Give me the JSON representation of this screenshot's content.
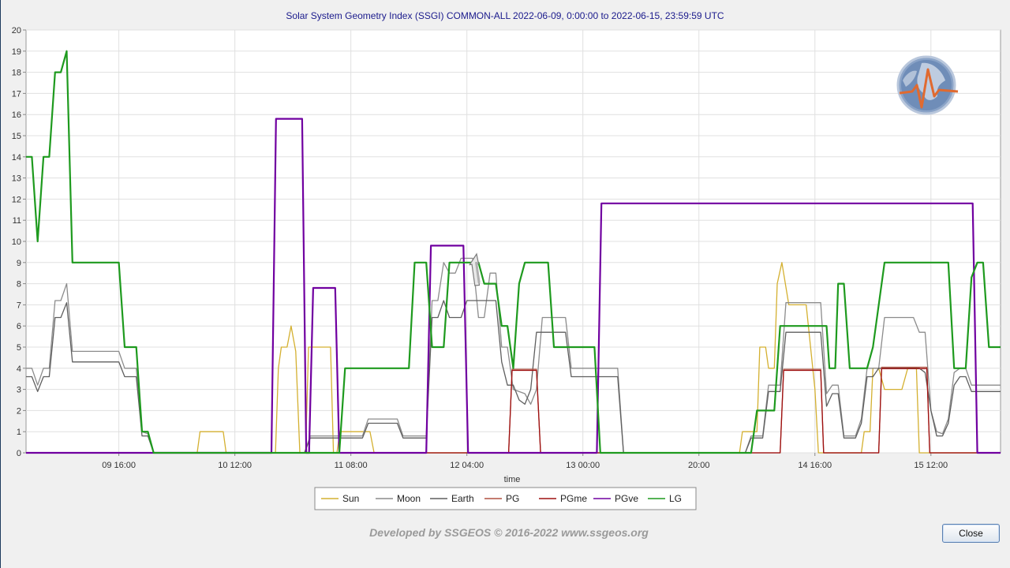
{
  "window": {
    "footer": "Developed by SSGEOS © 2016-2022 www.ssgeos.org",
    "close_label": "Close",
    "logo_icon": "earth-seismograph-logo-icon"
  },
  "chart_data": {
    "type": "line",
    "title": "Solar System Geometry Index (SSGI) COMMON-ALL 2022-06-09,  0:00:00 to 2022-06-15, 23:59:59 UTC",
    "xlabel": "time",
    "ylabel": "",
    "x_unit": "hours from 2022-06-09 00:00 UTC",
    "xlim": [
      0,
      168
    ],
    "ylim": [
      0,
      20
    ],
    "y_ticks": [
      0,
      1,
      2,
      3,
      4,
      5,
      6,
      7,
      8,
      9,
      10,
      11,
      12,
      13,
      14,
      15,
      16,
      17,
      18,
      19,
      20
    ],
    "x_ticks": [
      {
        "x": 16,
        "label": "09 16:00"
      },
      {
        "x": 36,
        "label": "10 12:00"
      },
      {
        "x": 56,
        "label": "11 08:00"
      },
      {
        "x": 76,
        "label": "12 04:00"
      },
      {
        "x": 96,
        "label": "13 00:00"
      },
      {
        "x": 116,
        "label": "20:00"
      },
      {
        "x": 136,
        "label": "14 16:00"
      },
      {
        "x": 156,
        "label": "15 12:00"
      }
    ],
    "grid": true,
    "legend_position": "bottom-center",
    "series": [
      {
        "name": "Sun",
        "color": "#d4b030",
        "points": [
          [
            0,
            0
          ],
          [
            29.5,
            0
          ],
          [
            30,
            1
          ],
          [
            34,
            1
          ],
          [
            34.5,
            0
          ],
          [
            43,
            0
          ],
          [
            43.5,
            4
          ],
          [
            44,
            5
          ],
          [
            45,
            5
          ],
          [
            45.7,
            6
          ],
          [
            46.5,
            4.8
          ],
          [
            47.2,
            0
          ],
          [
            48.2,
            0
          ],
          [
            48.7,
            5
          ],
          [
            52.5,
            5
          ],
          [
            53,
            0
          ],
          [
            53.6,
            0
          ],
          [
            54.1,
            1
          ],
          [
            59.3,
            1
          ],
          [
            60,
            0
          ],
          [
            123,
            0
          ],
          [
            123.5,
            1
          ],
          [
            126,
            1
          ],
          [
            126.5,
            5
          ],
          [
            127.5,
            5
          ],
          [
            128,
            4
          ],
          [
            129,
            4
          ],
          [
            129.5,
            8
          ],
          [
            130.3,
            9
          ],
          [
            131.5,
            7
          ],
          [
            134.5,
            7
          ],
          [
            136,
            3
          ],
          [
            136.6,
            0
          ],
          [
            144,
            0
          ],
          [
            144.5,
            1
          ],
          [
            145.5,
            1
          ],
          [
            146,
            4
          ],
          [
            147,
            4
          ],
          [
            148,
            3
          ],
          [
            151,
            3
          ],
          [
            152,
            4
          ],
          [
            153.5,
            4
          ],
          [
            154,
            0
          ],
          [
            168,
            0
          ]
        ]
      },
      {
        "name": "Moon",
        "color": "#8c8c8c",
        "points": [
          [
            0,
            4
          ],
          [
            1,
            4
          ],
          [
            2,
            3.2
          ],
          [
            3,
            4
          ],
          [
            4,
            4
          ],
          [
            5,
            7.2
          ],
          [
            6,
            7.2
          ],
          [
            7,
            8
          ],
          [
            8,
            4.8
          ],
          [
            16,
            4.8
          ],
          [
            17,
            4
          ],
          [
            19,
            4
          ],
          [
            20,
            1
          ],
          [
            21,
            0.9
          ],
          [
            22,
            0
          ],
          [
            48,
            0
          ],
          [
            49,
            0.8
          ],
          [
            58,
            0.8
          ],
          [
            59,
            1.6
          ],
          [
            64,
            1.6
          ],
          [
            65,
            0.8
          ],
          [
            69,
            0.8
          ],
          [
            70,
            7.2
          ],
          [
            71,
            7.2
          ],
          [
            72,
            9
          ],
          [
            73,
            8.5
          ],
          [
            74,
            8.5
          ],
          [
            75,
            9.2
          ],
          [
            77,
            9.2
          ],
          [
            78,
            6.4
          ],
          [
            79,
            6.4
          ],
          [
            80,
            8.5
          ],
          [
            81,
            8.5
          ],
          [
            82,
            5
          ],
          [
            83,
            5
          ],
          [
            84,
            3
          ],
          [
            86,
            2.8
          ],
          [
            87,
            2.3
          ],
          [
            88,
            3
          ],
          [
            89,
            6.4
          ],
          [
            93,
            6.4
          ],
          [
            94,
            4
          ],
          [
            102,
            4
          ],
          [
            103,
            0
          ],
          [
            124,
            0
          ],
          [
            125,
            0.8
          ],
          [
            127,
            0.8
          ],
          [
            128,
            3.2
          ],
          [
            130,
            3.2
          ],
          [
            131,
            7.1
          ],
          [
            137,
            7.1
          ],
          [
            138,
            2.8
          ],
          [
            139,
            3.2
          ],
          [
            140,
            3.2
          ],
          [
            141,
            0.8
          ],
          [
            143,
            0.8
          ],
          [
            144,
            1.6
          ],
          [
            145,
            4
          ],
          [
            147,
            4
          ],
          [
            148,
            6.4
          ],
          [
            153,
            6.4
          ],
          [
            154,
            5.7
          ],
          [
            155,
            5.7
          ],
          [
            156,
            2
          ],
          [
            157,
            1
          ],
          [
            158,
            0.9
          ],
          [
            159,
            1.6
          ],
          [
            160,
            3.8
          ],
          [
            161,
            4
          ],
          [
            162,
            4
          ],
          [
            163,
            3.2
          ],
          [
            168,
            3.2
          ]
        ]
      },
      {
        "name": "Earth",
        "color": "#5f5f5f",
        "points": [
          [
            0,
            3.6
          ],
          [
            1,
            3.6
          ],
          [
            2,
            2.9
          ],
          [
            3,
            3.6
          ],
          [
            4,
            3.6
          ],
          [
            5,
            6.4
          ],
          [
            6,
            6.4
          ],
          [
            7,
            7.1
          ],
          [
            8,
            4.3
          ],
          [
            16,
            4.3
          ],
          [
            17,
            3.6
          ],
          [
            19,
            3.6
          ],
          [
            20,
            0.8
          ],
          [
            21,
            0.8
          ],
          [
            22,
            0
          ],
          [
            48,
            0
          ],
          [
            49,
            0.7
          ],
          [
            58,
            0.7
          ],
          [
            59,
            1.4
          ],
          [
            64,
            1.4
          ],
          [
            65,
            0.7
          ],
          [
            69,
            0.7
          ],
          [
            70,
            6.4
          ],
          [
            71,
            6.4
          ],
          [
            72,
            7.2
          ],
          [
            73,
            6.4
          ],
          [
            75,
            6.4
          ],
          [
            76,
            7.2
          ],
          [
            81,
            7.2
          ],
          [
            82,
            4.3
          ],
          [
            83,
            3.2
          ],
          [
            84,
            3.2
          ],
          [
            85,
            2.5
          ],
          [
            86,
            2.3
          ],
          [
            87,
            3
          ],
          [
            88,
            5.7
          ],
          [
            93,
            5.7
          ],
          [
            94,
            3.6
          ],
          [
            102,
            3.6
          ],
          [
            103,
            0
          ],
          [
            124,
            0
          ],
          [
            125,
            0.7
          ],
          [
            127,
            0.7
          ],
          [
            128,
            2.9
          ],
          [
            130,
            2.9
          ],
          [
            131,
            5.7
          ],
          [
            137,
            5.7
          ],
          [
            138,
            2.2
          ],
          [
            139,
            2.8
          ],
          [
            140,
            2.8
          ],
          [
            141,
            0.7
          ],
          [
            143,
            0.7
          ],
          [
            144,
            1.4
          ],
          [
            145,
            3.6
          ],
          [
            146,
            3.6
          ],
          [
            147,
            4
          ],
          [
            154,
            4
          ],
          [
            155,
            3.8
          ],
          [
            156,
            2
          ],
          [
            157,
            0.8
          ],
          [
            158,
            0.8
          ],
          [
            159,
            1.4
          ],
          [
            160,
            3.2
          ],
          [
            161,
            3.6
          ],
          [
            162,
            3.6
          ],
          [
            163,
            2.9
          ],
          [
            168,
            2.9
          ]
        ]
      },
      {
        "name": "PG",
        "color": "#b05040",
        "points": [
          [
            0,
            0
          ],
          [
            83.2,
            0
          ],
          [
            83.8,
            3.95
          ],
          [
            88,
            3.95
          ],
          [
            88.7,
            0
          ],
          [
            130,
            0
          ],
          [
            130.6,
            3.95
          ],
          [
            137,
            3.95
          ],
          [
            137.5,
            0
          ],
          [
            147,
            0
          ],
          [
            147.5,
            4.05
          ],
          [
            155.3,
            4.05
          ],
          [
            155.8,
            0
          ],
          [
            168,
            0
          ]
        ]
      },
      {
        "name": "PGme",
        "color": "#9e1010",
        "points": [
          [
            0,
            0
          ],
          [
            83.2,
            0
          ],
          [
            83.8,
            3.9
          ],
          [
            88,
            3.9
          ],
          [
            88.7,
            0
          ],
          [
            130,
            0
          ],
          [
            130.6,
            3.9
          ],
          [
            137,
            3.9
          ],
          [
            137.5,
            0
          ],
          [
            147,
            0
          ],
          [
            147.5,
            3.98
          ],
          [
            155.3,
            3.98
          ],
          [
            155.8,
            0
          ],
          [
            168,
            0
          ]
        ]
      },
      {
        "name": "PGve",
        "color": "#7000a0",
        "points": [
          [
            0,
            0
          ],
          [
            42.3,
            0
          ],
          [
            43.1,
            15.8
          ],
          [
            47.6,
            15.8
          ],
          [
            48.3,
            0
          ],
          [
            48.8,
            0
          ],
          [
            49.5,
            7.8
          ],
          [
            53.3,
            7.8
          ],
          [
            54,
            0
          ],
          [
            69,
            0
          ],
          [
            69.8,
            9.8
          ],
          [
            75.4,
            9.8
          ],
          [
            76.2,
            0
          ],
          [
            98.4,
            0
          ],
          [
            99.2,
            11.8
          ],
          [
            163.2,
            11.8
          ],
          [
            164,
            0
          ],
          [
            168,
            0
          ]
        ]
      },
      {
        "name": "LG",
        "color": "#1e9a1e",
        "points": [
          [
            0,
            14
          ],
          [
            1,
            14
          ],
          [
            2,
            10
          ],
          [
            3,
            14
          ],
          [
            4,
            14
          ],
          [
            5,
            18
          ],
          [
            6,
            18
          ],
          [
            7,
            19
          ],
          [
            8,
            9
          ],
          [
            16,
            9
          ],
          [
            17,
            5
          ],
          [
            19,
            5
          ],
          [
            20,
            1
          ],
          [
            21,
            1
          ],
          [
            22,
            0
          ],
          [
            54,
            0
          ],
          [
            55,
            4
          ],
          [
            66,
            4
          ],
          [
            67,
            9
          ],
          [
            69,
            9
          ],
          [
            70,
            5
          ],
          [
            72,
            5
          ],
          [
            73,
            9
          ],
          [
            78,
            9
          ],
          [
            79,
            8
          ],
          [
            81,
            8
          ],
          [
            82,
            6
          ],
          [
            83,
            6
          ],
          [
            84,
            4
          ],
          [
            85,
            8
          ],
          [
            86,
            9
          ],
          [
            90,
            9
          ],
          [
            91,
            5
          ],
          [
            98,
            5
          ],
          [
            99,
            0
          ],
          [
            125,
            0
          ],
          [
            126,
            2
          ],
          [
            129,
            2
          ],
          [
            130,
            6
          ],
          [
            138,
            6
          ],
          [
            138.5,
            4
          ],
          [
            139.5,
            4
          ],
          [
            140,
            8
          ],
          [
            141,
            8
          ],
          [
            142,
            4
          ],
          [
            145,
            4
          ],
          [
            146,
            5
          ],
          [
            148,
            9
          ],
          [
            159,
            9
          ],
          [
            160,
            4
          ],
          [
            162,
            4
          ],
          [
            163,
            8.3
          ],
          [
            164,
            9
          ],
          [
            165,
            9
          ],
          [
            166,
            5
          ],
          [
            168,
            5
          ]
        ]
      }
    ]
  }
}
